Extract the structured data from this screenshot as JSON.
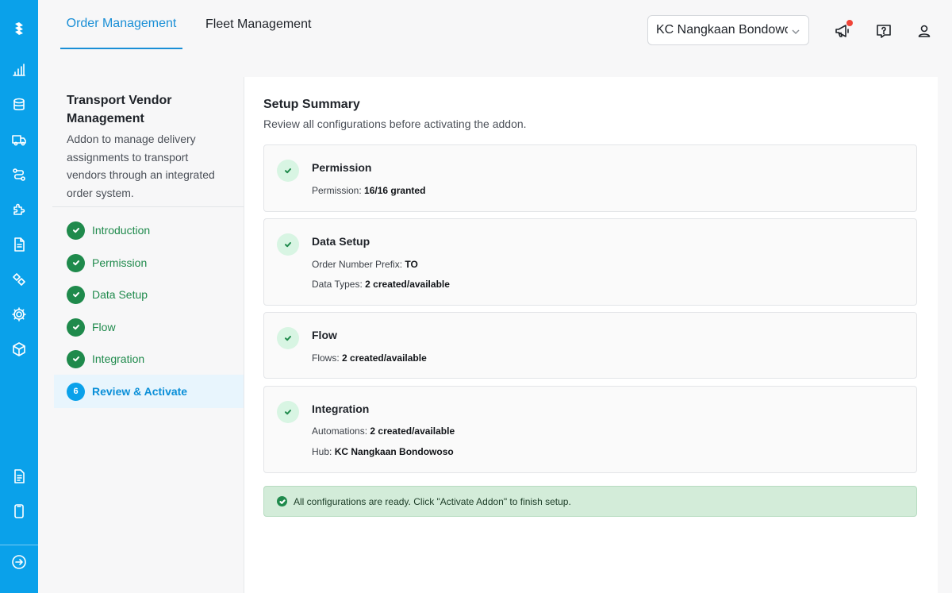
{
  "nav": {
    "tabs": [
      {
        "label": "Order Management",
        "active": true
      },
      {
        "label": "Fleet Management",
        "active": false
      }
    ],
    "hub_select": {
      "value": "KC Nangkaan Bondowoso"
    },
    "icons": [
      "announcement-icon",
      "help-icon",
      "user-icon"
    ]
  },
  "rail": {
    "icons": [
      "logo-icon",
      "analytics-icon",
      "database-icon",
      "truck-icon",
      "route-icon",
      "puzzle-icon",
      "document-icon",
      "tag-icon",
      "settings-icon",
      "box-icon",
      "report-icon",
      "mobile-icon",
      "logout-icon"
    ]
  },
  "wizard": {
    "title": "Transport Vendor Management",
    "description": "Addon to manage delivery assignments to transport vendors through an integrated order system.",
    "steps": [
      {
        "label": "Introduction",
        "status": "done"
      },
      {
        "label": "Permission",
        "status": "done"
      },
      {
        "label": "Data Setup",
        "status": "done"
      },
      {
        "label": "Flow",
        "status": "done"
      },
      {
        "label": "Integration",
        "status": "done"
      },
      {
        "label": "Review & Activate",
        "status": "active",
        "number": "6"
      }
    ]
  },
  "summary": {
    "title": "Setup Summary",
    "subtitle": "Review all configurations before activating the addon.",
    "cards": [
      {
        "title": "Permission",
        "lines": [
          {
            "label": "Permission:",
            "value": "16/16 granted"
          }
        ]
      },
      {
        "title": "Data Setup",
        "lines": [
          {
            "label": "Order Number Prefix:",
            "value": "TO"
          },
          {
            "label": "Data Types:",
            "value": "2 created/available"
          }
        ]
      },
      {
        "title": "Flow",
        "lines": [
          {
            "label": "Flows:",
            "value": "2 created/available"
          }
        ]
      },
      {
        "title": "Integration",
        "lines": [
          {
            "label": "Automations:",
            "value": "2 created/available"
          },
          {
            "label": "Hub:",
            "value": "KC Nangkaan Bondowoso"
          }
        ]
      }
    ],
    "ready_message": "All configurations are ready. Click \"Activate Addon\" to finish setup."
  },
  "colors": {
    "rail": "#0aa1ea",
    "accent": "#1a8fd6",
    "success": "#1f8a4c",
    "notification": "#f04438"
  }
}
